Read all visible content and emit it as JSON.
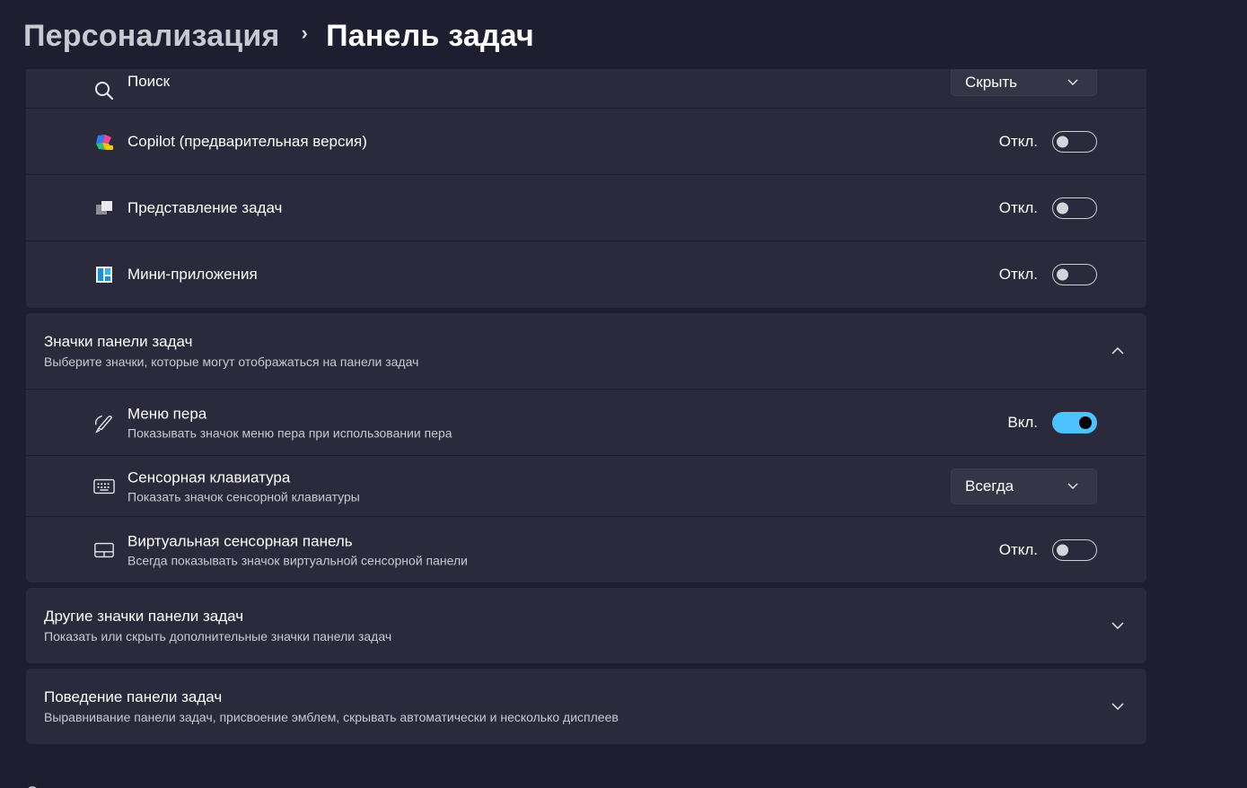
{
  "breadcrumb": {
    "parent": "Персонализация",
    "separator": "›",
    "current": "Панель задач"
  },
  "taskbar_items": [
    {
      "label": "Поиск",
      "icon": "search-icon",
      "control": "dropdown",
      "value": "Скрыть"
    },
    {
      "label": "Copilot (предварительная версия)",
      "icon": "copilot-icon",
      "control": "toggle",
      "state": "Откл.",
      "on": false
    },
    {
      "label": "Представление задач",
      "icon": "task-view-icon",
      "control": "toggle",
      "state": "Откл.",
      "on": false
    },
    {
      "label": "Мини-приложения",
      "icon": "widgets-icon",
      "control": "toggle",
      "state": "Откл.",
      "on": false
    }
  ],
  "taskbar_icons_section": {
    "title": "Значки панели задач",
    "description": "Выберите значки, которые могут отображаться на панели задач",
    "expanded": true,
    "items": [
      {
        "title": "Меню пера",
        "description": "Показывать значок меню пера при использовании пера",
        "icon": "pen-icon",
        "control": "toggle",
        "state": "Вкл.",
        "on": true
      },
      {
        "title": "Сенсорная клавиатура",
        "description": "Показать значок сенсорной клавиатуры",
        "icon": "keyboard-icon",
        "control": "dropdown",
        "value": "Всегда"
      },
      {
        "title": "Виртуальная сенсорная панель",
        "description": "Всегда показывать значок виртуальной сенсорной панели",
        "icon": "touchpad-icon",
        "control": "toggle",
        "state": "Откл.",
        "on": false
      }
    ]
  },
  "other_icons_section": {
    "title": "Другие значки панели задач",
    "description": "Показать или скрыть дополнительные значки панели задач",
    "expanded": false
  },
  "behavior_section": {
    "title": "Поведение панели задач",
    "description": "Выравнивание панели задач, присвоение эмблем, скрывать автоматически и несколько дисплеев",
    "expanded": false
  },
  "colors": {
    "background": "#1f1e30",
    "card": "#2b2a3c",
    "accent": "#4cc2ff"
  }
}
